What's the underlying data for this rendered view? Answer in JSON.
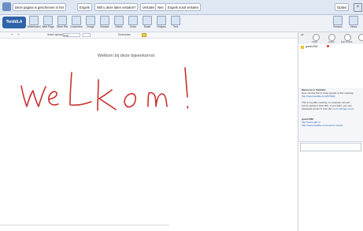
{
  "translate_bar": {
    "source_button": "Deze pagina is geschreven in het",
    "language": "Engels",
    "question": "Wilt u deze laten vertalen?",
    "translate": "Vertalen",
    "no": "Nee",
    "never": "Engels nooit vertalen",
    "options": "Opties"
  },
  "app": {
    "logo": "TwiddLA"
  },
  "toolbar": {
    "tools": [
      "Whiteboard",
      "Web Page",
      "Other Ref",
      "Document",
      "Image",
      "Browse",
      "Select",
      "Draw",
      "Erase",
      "Shapes",
      "Text"
    ],
    "right_tools": [
      "Session",
      "Views"
    ],
    "version": "bu 01/0"
  },
  "subbar": {
    "label1": "Select options",
    "font": "Arial",
    "label2": "Description"
  },
  "canvas": {
    "heading": "Welkom bij deze bijeenkomst",
    "handwriting": "weLkom!"
  },
  "panel": {
    "tabs": [
      "Invite",
      "Audio",
      "Edit Profile"
    ],
    "user": "guest1082",
    "chat": {
      "title": "Welcome to Twiddla!",
      "line1": "Give out this link to invite people to this meeting:",
      "link1": "http://www.twiddla.com/578302",
      "line2a": "This is a public meeting, so anybody can join",
      "line2b": "just by typing in that URL. If you want, you can",
      "line2c": "password-protect it from the",
      "settings": "room settings menu",
      "user": "guest1082",
      "link2": "http://www.rijdt.nl",
      "link3": "http://www.twiddla.com/meetinc.html#..."
    }
  }
}
